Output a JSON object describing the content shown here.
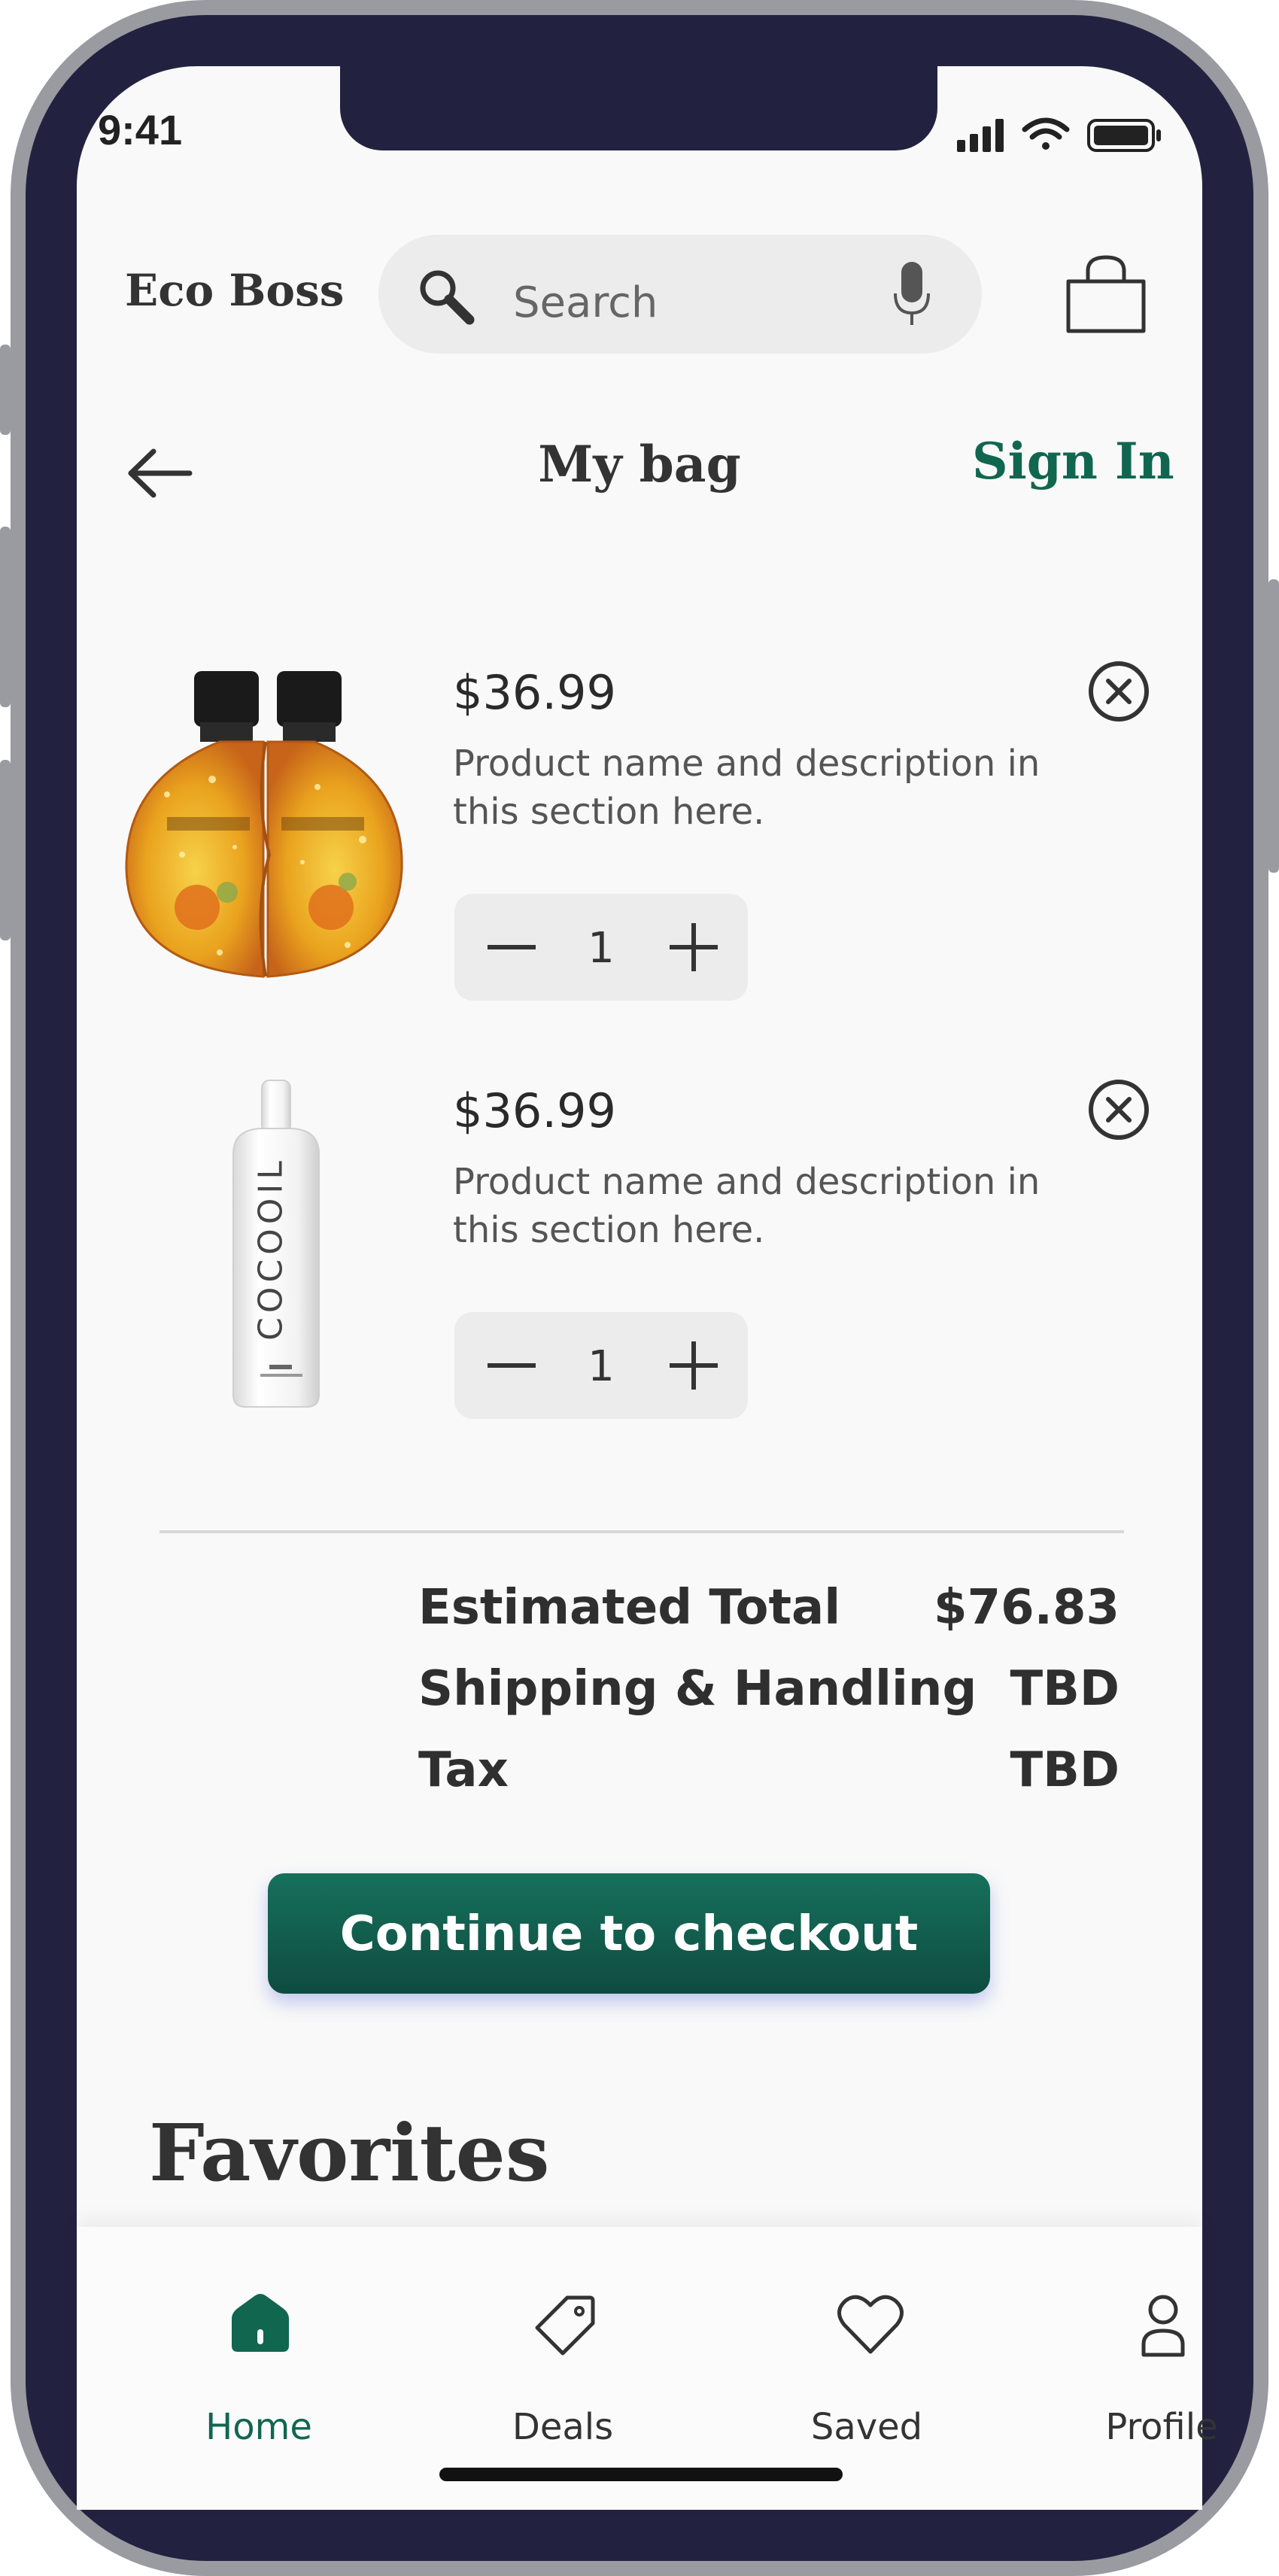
{
  "status_bar": {
    "time": "9:41"
  },
  "header": {
    "brand": "Eco Boss",
    "search_placeholder": "Search"
  },
  "nav": {
    "title": "My bag",
    "sign_in": "Sign In"
  },
  "cart": {
    "items": [
      {
        "price": "$36.99",
        "description": "Product name and description in this section here.",
        "quantity": "1",
        "image": "amber-oil-bottles"
      },
      {
        "price": "$36.99",
        "description": "Product name and description in this section here.",
        "quantity": "1",
        "image": "cocooil-bottle",
        "bottle_text": "COCOOIL"
      }
    ]
  },
  "summary": {
    "rows": [
      {
        "label": "Estimated Total",
        "value": "$76.83"
      },
      {
        "label": "Shipping & Handling",
        "value": "TBD"
      },
      {
        "label": "Tax",
        "value": "TBD"
      }
    ]
  },
  "checkout_button": "Continue to checkout",
  "favorites_heading": "Favorites",
  "tabbar": {
    "tabs": [
      {
        "label": "Home",
        "icon": "home-icon",
        "active": true
      },
      {
        "label": "Deals",
        "icon": "tag-icon",
        "active": false
      },
      {
        "label": "Saved",
        "icon": "heart-icon",
        "active": false
      },
      {
        "label": "Profile",
        "icon": "user-icon",
        "active": false
      }
    ]
  },
  "colors": {
    "accent": "#116650",
    "frame": "#222240",
    "background": "#f9f9f9"
  }
}
